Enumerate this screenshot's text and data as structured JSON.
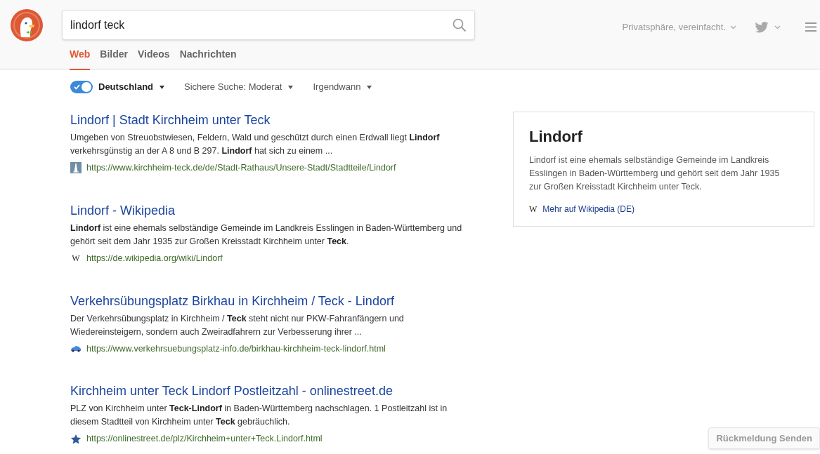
{
  "search": {
    "value": "lindorf teck"
  },
  "header_right": {
    "tagline": "Privatsphäre, vereinfacht."
  },
  "tabs": [
    {
      "label": "Web",
      "selected": true
    },
    {
      "label": "Bilder",
      "selected": false
    },
    {
      "label": "Videos",
      "selected": false
    },
    {
      "label": "Nachrichten",
      "selected": false
    }
  ],
  "filters": {
    "region": {
      "label": "Deutschland",
      "on": true
    },
    "dropdowns": [
      "Sichere Suche: Moderat",
      "Irgendwann"
    ]
  },
  "results": [
    {
      "title": "Lindorf | Stadt Kirchheim unter Teck",
      "snippet": "Umgeben von Streuobstwiesen, Feldern, Wald und geschützt durch einen Erdwall liegt **Lindorf** verkehrsgünstig an der A 8 und B 297. **Lindorf** hat sich zu einem ...",
      "favicon": {
        "kind": "tower"
      },
      "url": "https://www.kirchheim-teck.de/de/Stadt-Rathaus/Unsere-Stadt/Stadtteile/Lindorf"
    },
    {
      "title": "Lindorf - Wikipedia",
      "snippet": "**Lindorf** ist eine ehemals selbständige Gemeinde im Landkreis Esslingen in Baden-Württemberg und gehört seit dem Jahr 1935 zur Großen Kreisstadt Kirchheim unter **Teck**.",
      "favicon": {
        "kind": "letter",
        "text": "W"
      },
      "url": "https://de.wikipedia.org/wiki/Lindorf"
    },
    {
      "title": "Verkehrsübungsplatz Birkhau in Kirchheim / Teck - Lindorf",
      "snippet": "Der Verkehrsübungsplatz in Kirchheim / **Teck** steht nicht nur PKW-Fahranfängern und Wiedereinsteigern, sondern auch Zweiradfahrern zur Verbesserung ihrer ...",
      "favicon": {
        "kind": "car"
      },
      "url": "https://www.verkehrsuebungsplatz-info.de/birkhau-kirchheim-teck-lindorf.html"
    },
    {
      "title": "Kirchheim unter Teck Lindorf Postleitzahl - onlinestreet.de",
      "snippet": "PLZ von Kirchheim unter **Teck-Lindorf** in Baden-Württemberg nachschlagen. 1 Postleitzahl ist in diesem Stadtteil von Kirchheim unter **Teck** gebräuchlich.",
      "favicon": {
        "kind": "star"
      },
      "url": "https://onlinestreet.de/plz/Kirchheim+unter+Teck.Lindorf.html"
    }
  ],
  "infobox": {
    "title": "Lindorf",
    "text": "Lindorf ist eine ehemals selbständige Gemeinde im Landkreis Esslingen in Baden-Württemberg und gehört seit dem Jahr 1935 zur Großen Kreisstadt Kirchheim unter Teck.",
    "icon_text": "W",
    "link": "Mehr auf Wikipedia (DE)"
  },
  "feedback_button": "Rückmeldung Senden"
}
